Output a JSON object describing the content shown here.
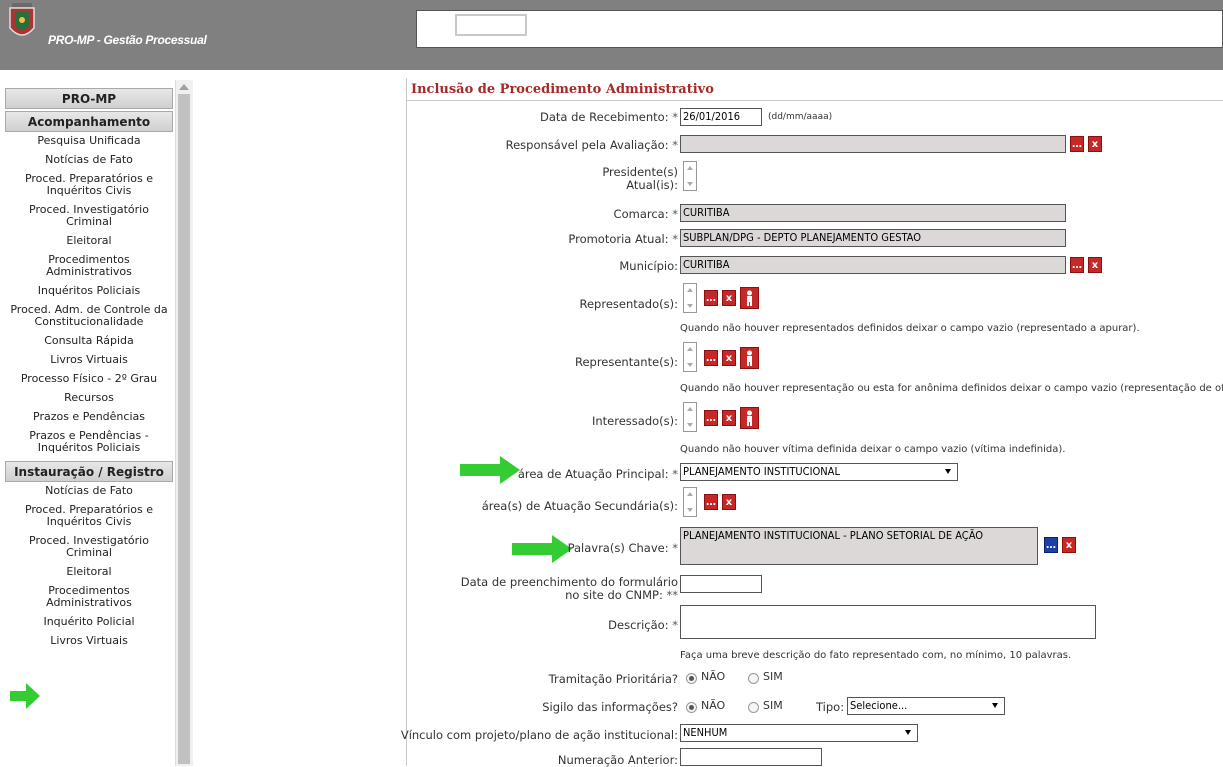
{
  "header": {
    "app_title": "PRO-MP - Gestão Processual"
  },
  "sidebar": {
    "top": "PRO-MP",
    "section1": "Acompanhamento",
    "items1": [
      "Pesquisa Unificada",
      "Notícias de Fato",
      "Proced. Preparatórios e Inquéritos Civis",
      "Proced. Investigatório Criminal",
      "Eleitoral",
      "Procedimentos Administrativos",
      "Inquéritos Policiais",
      "Proced. Adm. de Controle da Constitucionalidade",
      "Consulta Rápida",
      "Livros Virtuais",
      "Processo Físico - 2º Grau",
      "Recursos",
      "Prazos e Pendências",
      "Prazos e Pendências - Inquéritos Policiais"
    ],
    "section2": "Instauração / Registro",
    "items2": [
      "Notícias de Fato",
      "Proced. Preparatórios e Inquéritos Civis",
      "Proced. Investigatório Criminal",
      "Eleitoral",
      "Procedimentos Administrativos",
      "Inquérito Policial",
      "Livros Virtuais"
    ]
  },
  "form": {
    "title": "Inclusão de Procedimento Administrativo",
    "data_recebimento_label": "Data de Recebimento:",
    "data_recebimento_value": "26/01/2016",
    "date_format_hint": "(dd/mm/aaaa)",
    "responsavel_label": "Responsável pela Avaliação:",
    "presidente_label_1": "Presidente(s)",
    "presidente_label_2": "Atual(is):",
    "comarca_label": "Comarca:",
    "comarca_value": "CURITIBA",
    "promotoria_label": "Promotoria Atual:",
    "promotoria_value": "SUBPLAN/DPG - DEPTO PLANEJAMENTO GESTAO",
    "municipio_label": "Município:",
    "municipio_value": "CURITIBA",
    "representado_label": "Representado(s):",
    "representado_hint": "Quando não houver representados definidos deixar o campo vazio (representado a apurar).",
    "representante_label": "Representante(s):",
    "representante_hint": "Quando não houver representação ou esta for anônima definidos deixar o campo vazio (representação de ofício).",
    "interessado_label": "Interessado(s):",
    "interessado_hint": "Quando não houver vítima definida deixar o campo vazio (vítima indefinida).",
    "area_principal_label": "área de Atuação Principal:",
    "area_principal_value": "PLANEJAMENTO INSTITUCIONAL",
    "area_secundaria_label": "área(s) de Atuação Secundária(s):",
    "palavras_label": "Palavra(s) Chave:",
    "palavras_value": "PLANEJAMENTO INSTITUCIONAL - PLANO SETORIAL DE AÇÃO",
    "data_cnmp_label_1": "Data de preenchimento do formulário",
    "data_cnmp_label_2": "no site do CNMP:",
    "descricao_label": "Descrição:",
    "descricao_hint": "Faça uma breve descrição do fato representado com, no mínimo, 10 palavras.",
    "tramitacao_label": "Tramitação Prioritária?",
    "sigilo_label": "Sigilo das informações?",
    "nao": "NÃO",
    "sim": "SIM",
    "tipo_label": "Tipo:",
    "tipo_value": "Selecione...",
    "vinculo_label": "Vínculo com projeto/plano de ação institucional:",
    "vinculo_value": "NENHUM",
    "numeracao_label": "Numeração Anterior:",
    "req": "*",
    "req2": "**"
  },
  "colors": {
    "accent_red": "#c62828",
    "title_red": "#a52a2a",
    "arrow_green": "#33cc33"
  }
}
